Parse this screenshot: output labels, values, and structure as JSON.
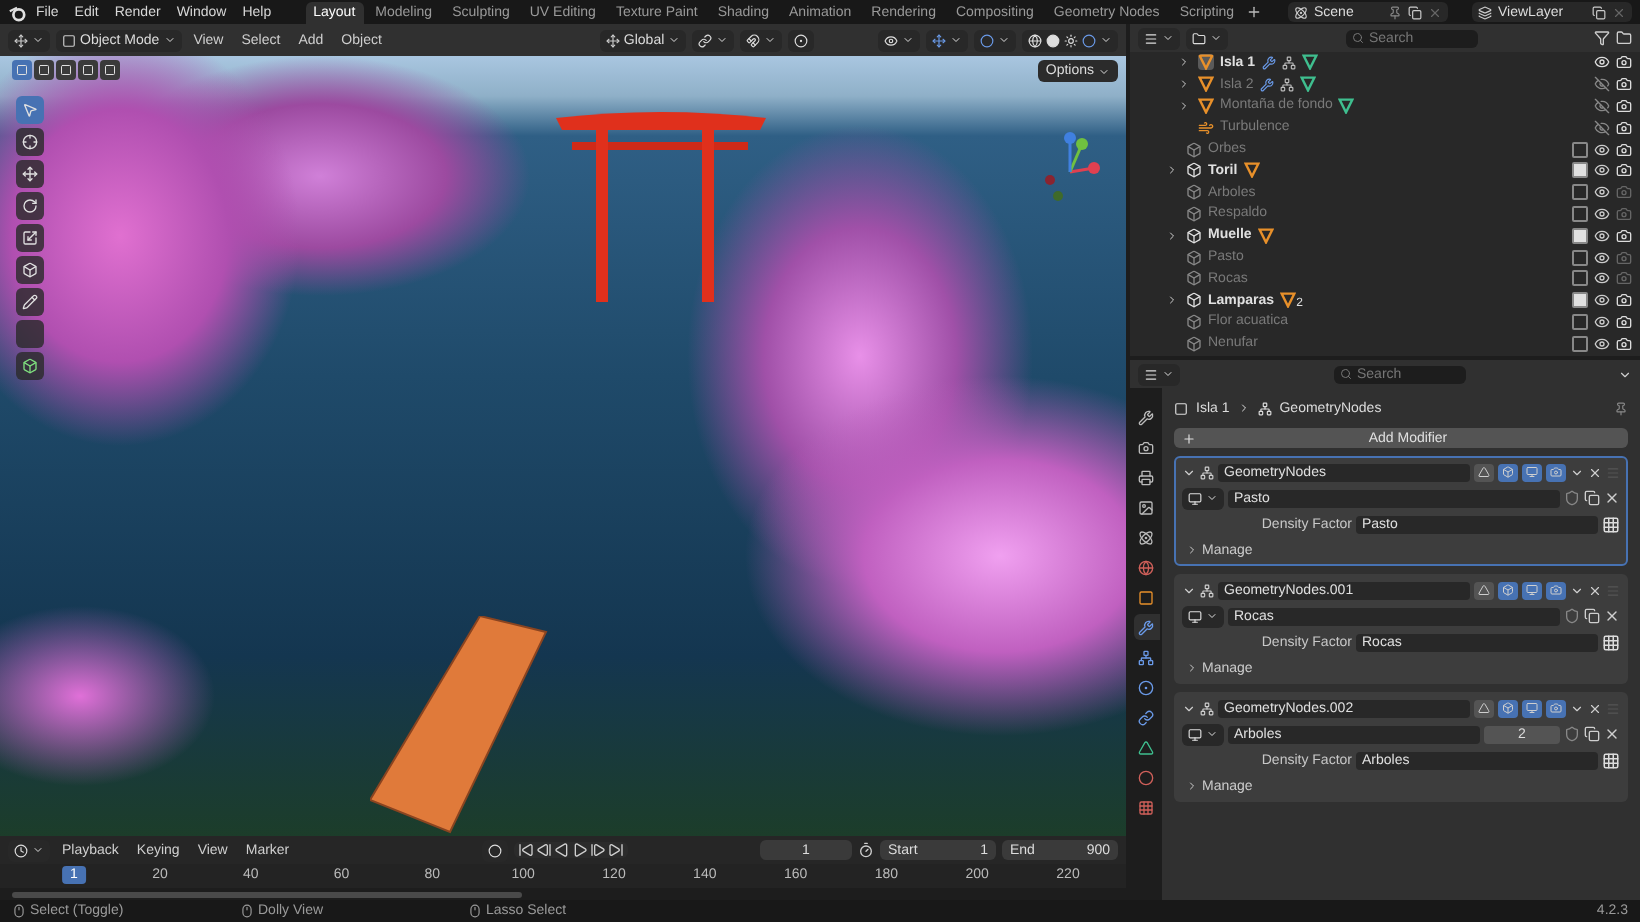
{
  "menu": [
    "File",
    "Edit",
    "Render",
    "Window",
    "Help"
  ],
  "workspaces": [
    {
      "label": "Layout",
      "selected": true
    },
    {
      "label": "Modeling",
      "selected": false
    },
    {
      "label": "Sculpting",
      "selected": false
    },
    {
      "label": "UV Editing",
      "selected": false
    },
    {
      "label": "Texture Paint",
      "selected": false
    },
    {
      "label": "Shading",
      "selected": false
    },
    {
      "label": "Animation",
      "selected": false
    },
    {
      "label": "Rendering",
      "selected": false
    },
    {
      "label": "Compositing",
      "selected": false
    },
    {
      "label": "Geometry Nodes",
      "selected": false
    },
    {
      "label": "Scripting",
      "selected": false
    }
  ],
  "scene": {
    "value": "Scene"
  },
  "view_layer": {
    "value": "ViewLayer"
  },
  "viewport": {
    "mode": "Object Mode",
    "menus": [
      "View",
      "Select",
      "Add",
      "Object"
    ],
    "orientation": "Global",
    "options": "Options"
  },
  "outliner": {
    "search": {
      "placeholder": "Search"
    },
    "nested_items": [
      {
        "name": "Isla 1",
        "kind": "mesh",
        "selected": true,
        "visible": true,
        "expandable": true,
        "modifiers": true
      },
      {
        "name": "Isla 2",
        "kind": "mesh",
        "selected": false,
        "visible": false,
        "expandable": true,
        "modifiers": true
      },
      {
        "name": "Montaña de fondo",
        "kind": "mesh",
        "selected": false,
        "visible": false,
        "expandable": true,
        "modifiers": false
      },
      {
        "name": "Turbulence",
        "kind": "force",
        "selected": false,
        "visible": false,
        "expandable": false,
        "modifiers": false
      }
    ],
    "collections": [
      {
        "name": "Orbes",
        "checked": false,
        "expandable": false,
        "renderable": true,
        "has_mesh": false
      },
      {
        "name": "Toril",
        "checked": true,
        "expandable": true,
        "renderable": true,
        "has_mesh": true
      },
      {
        "name": "Arboles",
        "checked": false,
        "expandable": false,
        "renderable": false,
        "has_mesh": false
      },
      {
        "name": "Respaldo",
        "checked": false,
        "expandable": false,
        "renderable": false,
        "has_mesh": false
      },
      {
        "name": "Muelle",
        "checked": true,
        "expandable": true,
        "renderable": true,
        "has_mesh": true
      },
      {
        "name": "Pasto",
        "checked": false,
        "expandable": false,
        "renderable": false,
        "has_mesh": false
      },
      {
        "name": "Rocas",
        "checked": false,
        "expandable": false,
        "renderable": false,
        "has_mesh": false
      },
      {
        "name": "Lamparas",
        "checked": true,
        "expandable": true,
        "renderable": true,
        "has_mesh": true,
        "mesh_count": "2"
      },
      {
        "name": "Flor acuatica",
        "checked": false,
        "expandable": false,
        "renderable": true,
        "has_mesh": false
      },
      {
        "name": "Nenufar",
        "checked": false,
        "expandable": false,
        "renderable": true,
        "has_mesh": false
      }
    ]
  },
  "properties": {
    "search": {
      "placeholder": "Search"
    },
    "tabs": [
      {
        "kind": "tool",
        "selected": false
      },
      {
        "kind": "render",
        "selected": false
      },
      {
        "kind": "output",
        "selected": false
      },
      {
        "kind": "view_layer",
        "selected": false
      },
      {
        "kind": "scene",
        "selected": false
      },
      {
        "kind": "world",
        "selected": false
      },
      {
        "kind": "object",
        "selected": false
      },
      {
        "kind": "modifiers",
        "selected": true
      },
      {
        "kind": "particles",
        "selected": false
      },
      {
        "kind": "physics",
        "selected": false
      },
      {
        "kind": "constraints",
        "selected": false
      },
      {
        "kind": "data",
        "selected": false
      },
      {
        "kind": "material",
        "selected": false
      },
      {
        "kind": "texture",
        "selected": false
      }
    ],
    "breadcrumb": [
      "Isla 1",
      "GeometryNodes"
    ],
    "add_modifier": "Add Modifier",
    "modifiers": [
      {
        "name": "GeometryNodes",
        "active": true,
        "expanded": true,
        "node_group": "Pasto",
        "input_label": "Density Factor",
        "input_value": "Pasto",
        "manage": "Manage"
      },
      {
        "name": "GeometryNodes.001",
        "active": false,
        "expanded": true,
        "node_group": "Rocas",
        "input_label": "Density Factor",
        "input_value": "Rocas",
        "manage": "Manage"
      },
      {
        "name": "GeometryNodes.002",
        "active": false,
        "expanded": true,
        "node_group": "Arboles",
        "users": "2",
        "input_label": "Density Factor",
        "input_value": "Arboles",
        "manage": "Manage"
      }
    ]
  },
  "timeline": {
    "menus": [
      "Playback",
      "Keying",
      "View",
      "Marker"
    ],
    "current_frame": "1",
    "start_label": "Start",
    "start": "1",
    "end_label": "End",
    "end": "900",
    "marker_frame": "1",
    "ticks": [
      "20",
      "40",
      "60",
      "80",
      "100",
      "120",
      "140",
      "160",
      "180",
      "200",
      "220"
    ]
  },
  "status_bar": {
    "hints": [
      "Select (Toggle)",
      "Dolly View",
      "Lasso Select"
    ],
    "version": "4.2.3"
  }
}
